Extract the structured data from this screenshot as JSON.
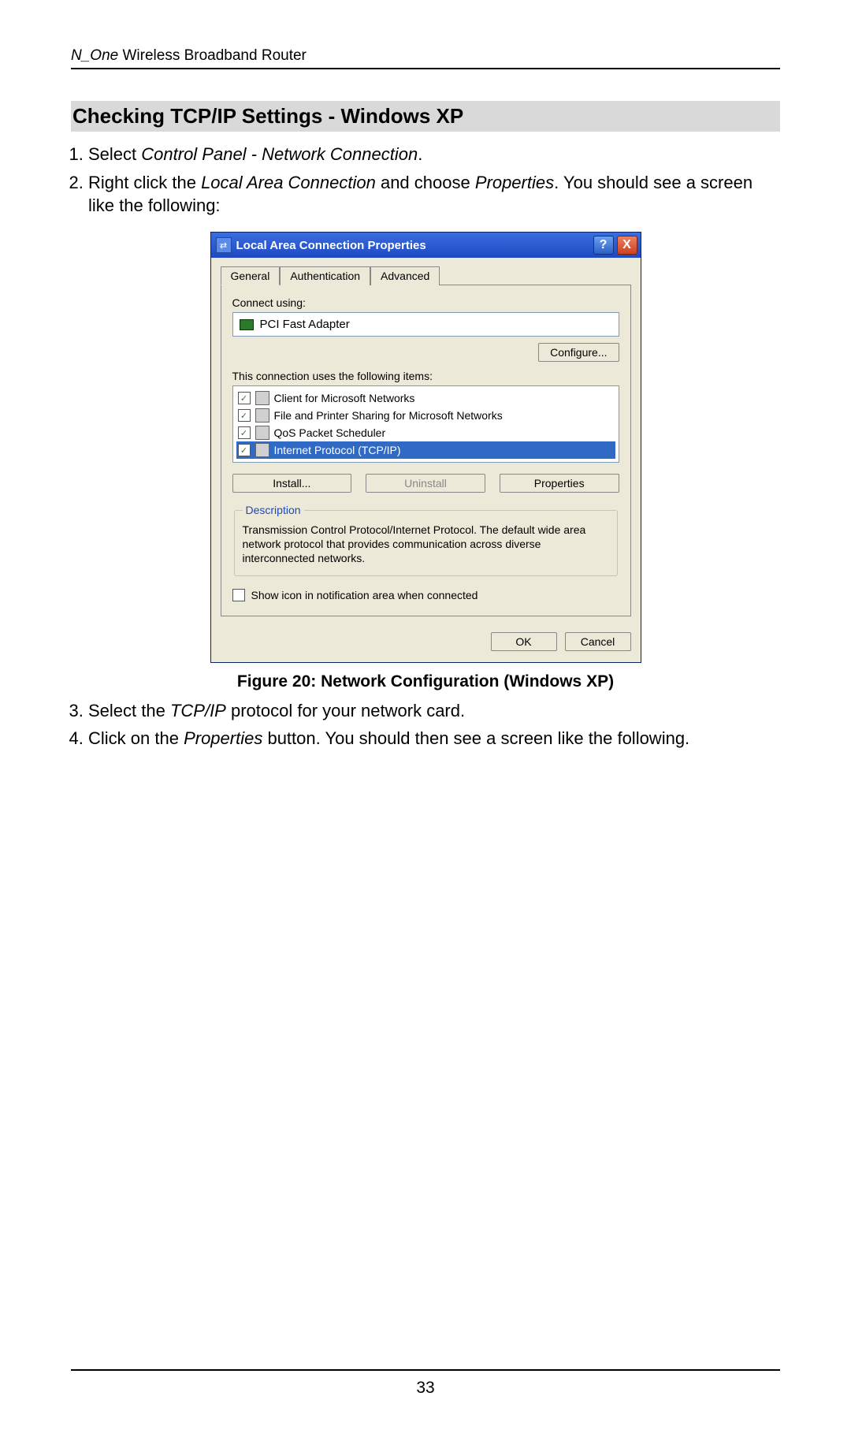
{
  "header": {
    "product_italic": "N_One",
    "product_rest": " Wireless Broadband Router"
  },
  "section_title": "Checking TCP/IP Settings - Windows XP",
  "steps": {
    "s1_a": "Select ",
    "s1_b": "Control Panel - Network Connection",
    "s1_c": ".",
    "s2_a": "Right click the ",
    "s2_b": "Local Area Connection",
    "s2_c": " and choose ",
    "s2_d": "Properties",
    "s2_e": ". You should see a screen like the following:",
    "s3_a": "Select the ",
    "s3_b": "TCP/IP",
    "s3_c": " protocol for your network card.",
    "s4_a": "Click on the ",
    "s4_b": "Properties",
    "s4_c": " button. You should then see a screen like the following."
  },
  "dialog": {
    "title": "Local Area Connection Properties",
    "help": "?",
    "close": "X",
    "tabs": {
      "general": "General",
      "auth": "Authentication",
      "adv": "Advanced"
    },
    "connect_using_label": "Connect using:",
    "adapter": "PCI Fast Adapter",
    "configure": "Configure...",
    "items_label": "This connection uses the following items:",
    "items": [
      "Client for Microsoft Networks",
      "File and Printer Sharing for Microsoft Networks",
      "QoS Packet Scheduler",
      "Internet Protocol (TCP/IP)"
    ],
    "install": "Install...",
    "uninstall": "Uninstall",
    "properties": "Properties",
    "desc_legend": "Description",
    "desc_text": "Transmission Control Protocol/Internet Protocol. The default wide area network protocol that provides communication across diverse interconnected networks.",
    "show_icon": "Show icon in notification area when connected",
    "ok": "OK",
    "cancel": "Cancel",
    "check": "✓"
  },
  "caption": "Figure 20: Network Configuration (Windows XP)",
  "page_number": "33"
}
